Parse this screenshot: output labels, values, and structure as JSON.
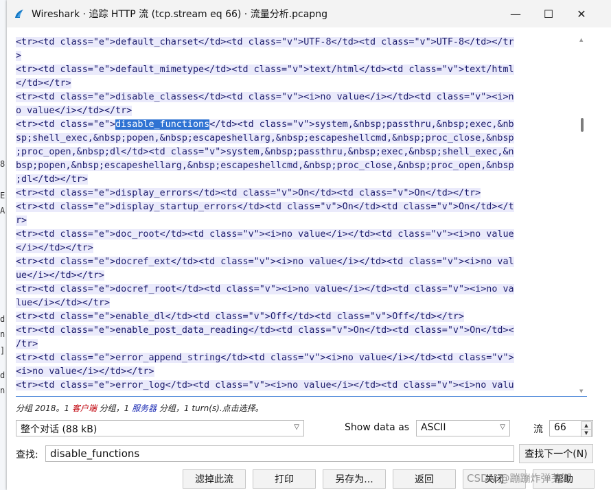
{
  "window": {
    "title": "Wireshark · 追踪 HTTP 流 (tcp.stream eq 66) · 流量分析.pcapng",
    "minimize_glyph": "—",
    "maximize_glyph": "☐",
    "close_glyph": "✕"
  },
  "background_fragments": [
    "8",
    "E",
    "A",
    "d",
    "n",
    "]",
    "d",
    "n"
  ],
  "stream": {
    "lines": [
      {
        "text": "<tr><td class=\"e\">default_charset</td><td class=\"v\">UTF-8</td><td class=\"v\">UTF-8</td></tr"
      },
      {
        "text": ">"
      },
      {
        "text": "<tr><td class=\"e\">default_mimetype</td><td class=\"v\">text/html</td><td class=\"v\">text/html"
      },
      {
        "text": "</td></tr>"
      },
      {
        "text": "<tr><td class=\"e\">disable_classes</td><td class=\"v\"><i>no value</i></td><td class=\"v\"><i>n"
      },
      {
        "text": "o value</i></td></tr>"
      },
      {
        "pre": "<tr><td class=\"e\">",
        "hl": "disable_functions",
        "post": "</td><td class=\"v\">system,&nbsp;passthru,&nbsp;exec,&nb"
      },
      {
        "text": "sp;shell_exec,&nbsp;popen,&nbsp;escapeshellarg,&nbsp;escapeshellcmd,&nbsp;proc_close,&nbsp"
      },
      {
        "text": ";proc_open,&nbsp;dl</td><td class=\"v\">system,&nbsp;passthru,&nbsp;exec,&nbsp;shell_exec,&n"
      },
      {
        "text": "bsp;popen,&nbsp;escapeshellarg,&nbsp;escapeshellcmd,&nbsp;proc_close,&nbsp;proc_open,&nbsp"
      },
      {
        "text": ";dl</td></tr>"
      },
      {
        "text": "<tr><td class=\"e\">display_errors</td><td class=\"v\">On</td><td class=\"v\">On</td></tr>"
      },
      {
        "text": "<tr><td class=\"e\">display_startup_errors</td><td class=\"v\">On</td><td class=\"v\">On</td></t"
      },
      {
        "text": "r>"
      },
      {
        "text": "<tr><td class=\"e\">doc_root</td><td class=\"v\"><i>no value</i></td><td class=\"v\"><i>no value"
      },
      {
        "text": "</i></td></tr>"
      },
      {
        "text": "<tr><td class=\"e\">docref_ext</td><td class=\"v\"><i>no value</i></td><td class=\"v\"><i>no val"
      },
      {
        "text": "ue</i></td></tr>"
      },
      {
        "text": "<tr><td class=\"e\">docref_root</td><td class=\"v\"><i>no value</i></td><td class=\"v\"><i>no va"
      },
      {
        "text": "lue</i></td></tr>"
      },
      {
        "text": "<tr><td class=\"e\">enable_dl</td><td class=\"v\">Off</td><td class=\"v\">Off</td></tr>"
      },
      {
        "text": "<tr><td class=\"e\">enable_post_data_reading</td><td class=\"v\">On</td><td class=\"v\">On</td><"
      },
      {
        "text": "/tr>"
      },
      {
        "text": "<tr><td class=\"e\">error_append_string</td><td class=\"v\"><i>no value</i></td><td class=\"v\">"
      },
      {
        "text": "<i>no value</i></td></tr>"
      },
      {
        "text": "<tr><td class=\"e\">error_log</td><td class=\"v\"><i>no value</i></td><td class=\"v\"><i>no valu"
      }
    ]
  },
  "status": {
    "p1": "分组 2018。1 ",
    "client": "客户端",
    "p2": " 分组，1 ",
    "server": "服务器",
    "p3": " 分组，1 turn(s).点击选择。"
  },
  "conversation_select": "整个对话 (88 kB)",
  "show_data_as_label": "Show data as",
  "show_data_as_value": "ASCII",
  "stream_label": "流",
  "stream_value": "66",
  "find": {
    "label": "查找:",
    "value": "disable_functions",
    "next_button": "查找下一个(N)"
  },
  "buttons": {
    "filter_out": "滤掉此流",
    "print": "打印",
    "save_as": "另存为...",
    "back": "返回",
    "close": "关闭",
    "help": "帮助"
  },
  "watermark": "CSDN @蹦蹦炸弹芜湖",
  "colors": {
    "client_text": "#1c1c6c",
    "client_bg": "#eaeafb",
    "highlight": "#2f73d3",
    "client_label": "#c0000a",
    "server_label": "#1f2fb5"
  }
}
